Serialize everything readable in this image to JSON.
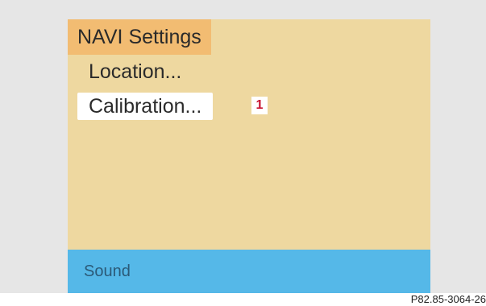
{
  "menu": {
    "title": "NAVI Settings",
    "items": [
      {
        "label": "Location..."
      },
      {
        "label": "Calibration..."
      }
    ],
    "selected_index": 1
  },
  "callout": {
    "number": "1",
    "color": "#c8102e"
  },
  "bottom_bar": {
    "label": "Sound",
    "color": "#55b8e8"
  },
  "figure_ref": "P82.85-3064-26",
  "colors": {
    "screen_bg": "#eed8a0",
    "header_bg": "#f2bc72",
    "highlight_bg": "#ffffff"
  }
}
